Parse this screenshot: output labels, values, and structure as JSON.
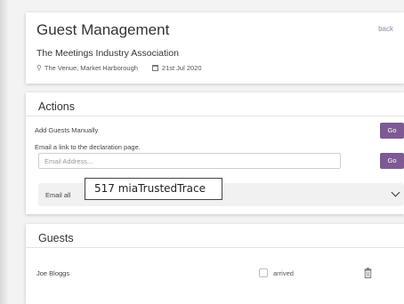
{
  "header": {
    "title": "Guest Management",
    "back_label": "back",
    "organisation": "The Meetings Industry Association",
    "venue": "The Venue, Market Harborough",
    "date": "21st Jul 2020"
  },
  "actions": {
    "title": "Actions",
    "add_guests_label": "Add Guests Manually",
    "add_guests_button": "Go",
    "email_link_label": "Email a link to the declaration page.",
    "email_placeholder": "Email Address...",
    "email_button": "Go",
    "accordion_label": "Email all",
    "tooltip_text": "517 miaTrustedTrace"
  },
  "guests": {
    "title": "Guests",
    "rows": [
      {
        "name": "Joe Bloggs",
        "status_label": "arrived"
      }
    ]
  },
  "colors": {
    "accent": "#7d5a94",
    "link": "#8a8aa8"
  }
}
